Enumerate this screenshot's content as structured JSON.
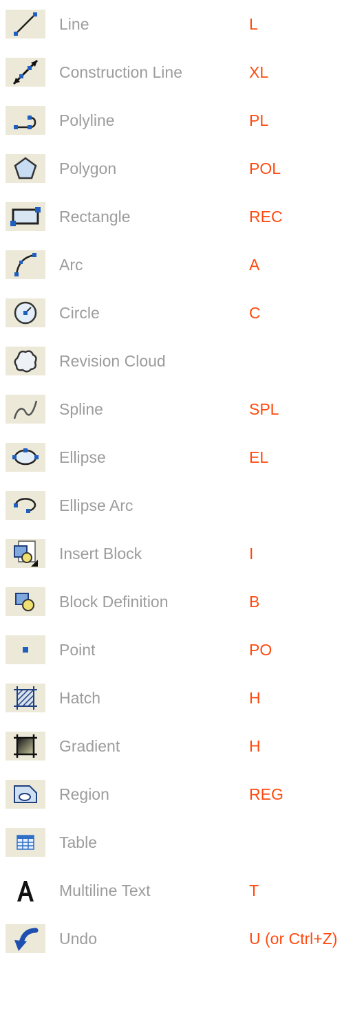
{
  "commands": [
    {
      "name": "Line",
      "shortcut": "L",
      "icon": "line-icon"
    },
    {
      "name": "Construction Line",
      "shortcut": "XL",
      "icon": "construction-line-icon"
    },
    {
      "name": "Polyline",
      "shortcut": "PL",
      "icon": "polyline-icon"
    },
    {
      "name": "Polygon",
      "shortcut": "POL",
      "icon": "polygon-icon"
    },
    {
      "name": "Rectangle",
      "shortcut": "REC",
      "icon": "rectangle-icon"
    },
    {
      "name": "Arc",
      "shortcut": "A",
      "icon": "arc-icon"
    },
    {
      "name": "Circle",
      "shortcut": "C",
      "icon": "circle-icon"
    },
    {
      "name": "Revision Cloud",
      "shortcut": "",
      "icon": "revision-cloud-icon"
    },
    {
      "name": "Spline",
      "shortcut": "SPL",
      "icon": "spline-icon"
    },
    {
      "name": "Ellipse",
      "shortcut": "EL",
      "icon": "ellipse-icon"
    },
    {
      "name": "Ellipse Arc",
      "shortcut": "",
      "icon": "ellipse-arc-icon"
    },
    {
      "name": "Insert Block",
      "shortcut": "I",
      "icon": "insert-block-icon"
    },
    {
      "name": "Block Definition",
      "shortcut": "B",
      "icon": "block-definition-icon"
    },
    {
      "name": "Point",
      "shortcut": "PO",
      "icon": "point-icon"
    },
    {
      "name": "Hatch",
      "shortcut": "H",
      "icon": "hatch-icon"
    },
    {
      "name": "Gradient",
      "shortcut": "H",
      "icon": "gradient-icon"
    },
    {
      "name": "Region",
      "shortcut": "REG",
      "icon": "region-icon"
    },
    {
      "name": "Table",
      "shortcut": "",
      "icon": "table-icon"
    },
    {
      "name": "Multiline Text",
      "shortcut": "T",
      "icon": "multiline-text-icon"
    },
    {
      "name": "Undo",
      "shortcut": "U (or Ctrl+Z)",
      "icon": "undo-icon"
    }
  ],
  "colors": {
    "name_text": "#9c9c9c",
    "shortcut_text": "#ff4a0f",
    "icon_background": "#ece9d8",
    "icon_blue": "#1f5fbf"
  }
}
